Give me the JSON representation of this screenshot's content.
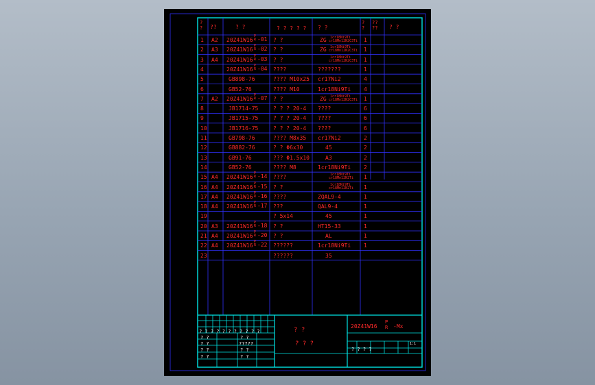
{
  "header": {
    "h1": "?\n?",
    "h2": "??",
    "h3": "? ?",
    "h4": "? ? ? ? ?",
    "h5": "? ?",
    "h6": "?\n?",
    "h7": "??\n??",
    "h8": "? ?"
  },
  "rows": [
    {
      "n": "1",
      "s": "A2",
      "code": "20Z41W16 -01",
      "name": "?  ?",
      "mat": "ZG",
      "mats": [
        "1cr18Ni9Ti",
        "cr18Mn12N2C3Ti"
      ],
      "q": "1"
    },
    {
      "n": "2",
      "s": "A3",
      "code": "20Z41W16 -02",
      "name": "?  ?",
      "mat": "ZG",
      "mats": [
        "1cr18Ni9Ti",
        "cr18Mn12N2C3Ti"
      ],
      "q": "1"
    },
    {
      "n": "3",
      "s": "A4",
      "code": "20Z41W16 -03",
      "name": "?  ?",
      "mat": "",
      "mats": [
        "1cr18Ni9Ti",
        "cr18Mn12N2C3Ti"
      ],
      "q": "1"
    },
    {
      "n": "4",
      "s": "",
      "code": "20Z41W16 -04",
      "name": "????",
      "mat": "???????",
      "mats": [],
      "q": "1"
    },
    {
      "n": "5",
      "s": "",
      "code": "GB898-76",
      "name": "????  M10x25",
      "mat": "cr17Ni2",
      "mats": [],
      "q": "4"
    },
    {
      "n": "6",
      "s": "",
      "code": "GB52-76",
      "name": "????   M10",
      "mat": "1cr18Ni9Ti",
      "mats": [],
      "q": "4"
    },
    {
      "n": "7",
      "s": "A2",
      "code": "20Z41W16 -07",
      "name": "?  ?",
      "mat": "ZG",
      "mats": [
        "1cr18Ni9Ti",
        "cr18Mn12N2C3Ti"
      ],
      "q": "1"
    },
    {
      "n": "8",
      "s": "",
      "code": "JB1714-75",
      "name": "?  ?  ?   20-4",
      "mat": "????",
      "mats": [],
      "q": "6"
    },
    {
      "n": "9",
      "s": "",
      "code": "JB1715-75",
      "name": "?  ?  ?   20-4",
      "mat": "????",
      "mats": [],
      "q": "6"
    },
    {
      "n": "10",
      "s": "",
      "code": "JB1716-75",
      "name": "?  ?  ?   20-4",
      "mat": "????",
      "mats": [],
      "q": "6"
    },
    {
      "n": "11",
      "s": "",
      "code": "GB798-76",
      "name": "????   M8x35",
      "mat": "cr17Ni2",
      "mats": [],
      "q": "2"
    },
    {
      "n": "12",
      "s": "",
      "code": "GB882-76",
      "name": "?   ?   Φ6x30",
      "mat": "45",
      "mats": [],
      "q": "2"
    },
    {
      "n": "13",
      "s": "",
      "code": "GB91-76",
      "name": "???   Φ1.5x10",
      "mat": "A3",
      "mats": [],
      "q": "2"
    },
    {
      "n": "14",
      "s": "",
      "code": "GB52-76",
      "name": "????    M8",
      "mat": "1cr18Ni9Ti",
      "mats": [],
      "q": "2"
    },
    {
      "n": "15",
      "s": "A4",
      "code": "20Z41W16 -14",
      "name": "????",
      "mat": "",
      "mats": [
        "1cr18Ni9Ti",
        "cr18Mn12N2Ti"
      ],
      "q": "1"
    },
    {
      "n": "16",
      "s": "A4",
      "code": "20Z41W16 -15",
      "name": "? ?",
      "mat": "",
      "mats": [
        "1cr18Ni9Ti",
        "cr18Mn12N2Ti"
      ],
      "q": "1"
    },
    {
      "n": "17",
      "s": "A4",
      "code": "20Z41W16 -16",
      "name": "????",
      "mat": "ZQAL9-4",
      "mats": [],
      "q": "1"
    },
    {
      "n": "18",
      "s": "A4",
      "code": "20Z41W16 -17",
      "name": "???",
      "mat": "QAL9-4",
      "mats": [],
      "q": "1"
    },
    {
      "n": "19",
      "s": "",
      "code": "",
      "name": "?      5x14",
      "mat": "45",
      "mats": [],
      "q": "1"
    },
    {
      "n": "20",
      "s": "A3",
      "code": "20Z41W16 -18",
      "name": "?  ?",
      "mat": "HT15-33",
      "mats": [],
      "q": "1"
    },
    {
      "n": "21",
      "s": "A4",
      "code": "20Z41W16 -20",
      "name": "?  ?",
      "mat": "AL",
      "mats": [],
      "q": "1"
    },
    {
      "n": "22",
      "s": "A4",
      "code": "20Z41W16 -22",
      "name": "??????",
      "mat": "1cr18Ni9Ti",
      "mats": [],
      "q": "1"
    },
    {
      "n": "23",
      "s": "",
      "code": "",
      "name": "??????",
      "mat": "35",
      "mats": [],
      "q": ""
    }
  ],
  "titleblock": {
    "leftrow": "? ? ? ? ? ? ? ? ? ? ?",
    "lq1": "?  ?",
    "lq2": "?  ?",
    "lq3": "?  ?",
    "lq4": "?  ?",
    "mq1": "?  ?",
    "mq2": "?????",
    "mq3": "?  ?",
    "mq4": "?  ?",
    "center1": "?    ?",
    "center2": "?  ?  ?",
    "drawing_no": "20Z41W16",
    "drawing_pr": "P\nR",
    "drawing_suffix": "-Mx",
    "rq": "?       ?       ?       ?",
    "box": "1:1"
  }
}
